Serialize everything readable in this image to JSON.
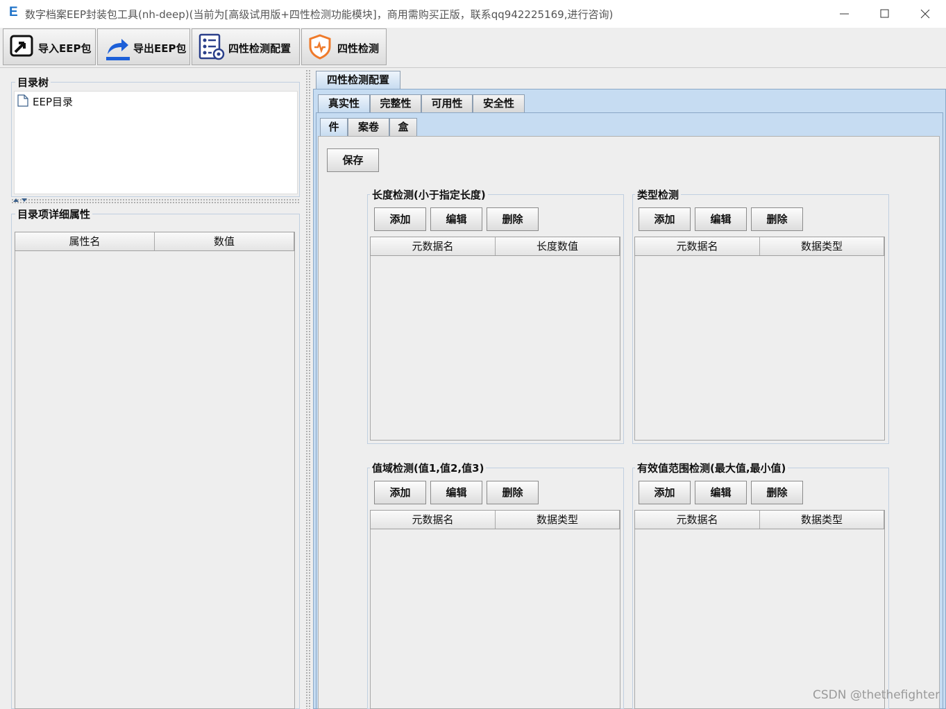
{
  "window": {
    "logo_letter": "E",
    "title": "数字档案EEP封装包工具(nh-deep)(当前为[高级试用版+四性检测功能模块]，商用需购买正版，联系qq942225169,进行咨询)"
  },
  "toolbar": {
    "import_label": "导入EEP包",
    "export_label": "导出EEP包",
    "config_label": "四性检测配置",
    "check_label": "四性检测"
  },
  "left": {
    "tree_title": "目录树",
    "tree_root": "EEP目录",
    "props_title": "目录项详细属性",
    "col_name": "属性名",
    "col_value": "数值"
  },
  "right": {
    "main_tab": "四性检测配置",
    "category_tabs": [
      "真实性",
      "完整性",
      "可用性",
      "安全性"
    ],
    "level_tabs": [
      "件",
      "案卷",
      "盒"
    ],
    "save_label": "保存",
    "groups": [
      {
        "title": "长度检测(小于指定长度)",
        "add": "添加",
        "edit": "编辑",
        "delete": "删除",
        "col1": "元数据名",
        "col2": "长度数值"
      },
      {
        "title": "类型检测",
        "add": "添加",
        "edit": "编辑",
        "delete": "删除",
        "col1": "元数据名",
        "col2": "数据类型"
      },
      {
        "title": "值域检测(值1,值2,值3)",
        "add": "添加",
        "edit": "编辑",
        "delete": "删除",
        "col1": "元数据名",
        "col2": "数据类型"
      },
      {
        "title": "有效值范围检测(最大值,最小值)",
        "add": "添加",
        "edit": "编辑",
        "delete": "删除",
        "col1": "元数据名",
        "col2": "数据类型"
      }
    ]
  },
  "watermark": "CSDN @thethefighter"
}
